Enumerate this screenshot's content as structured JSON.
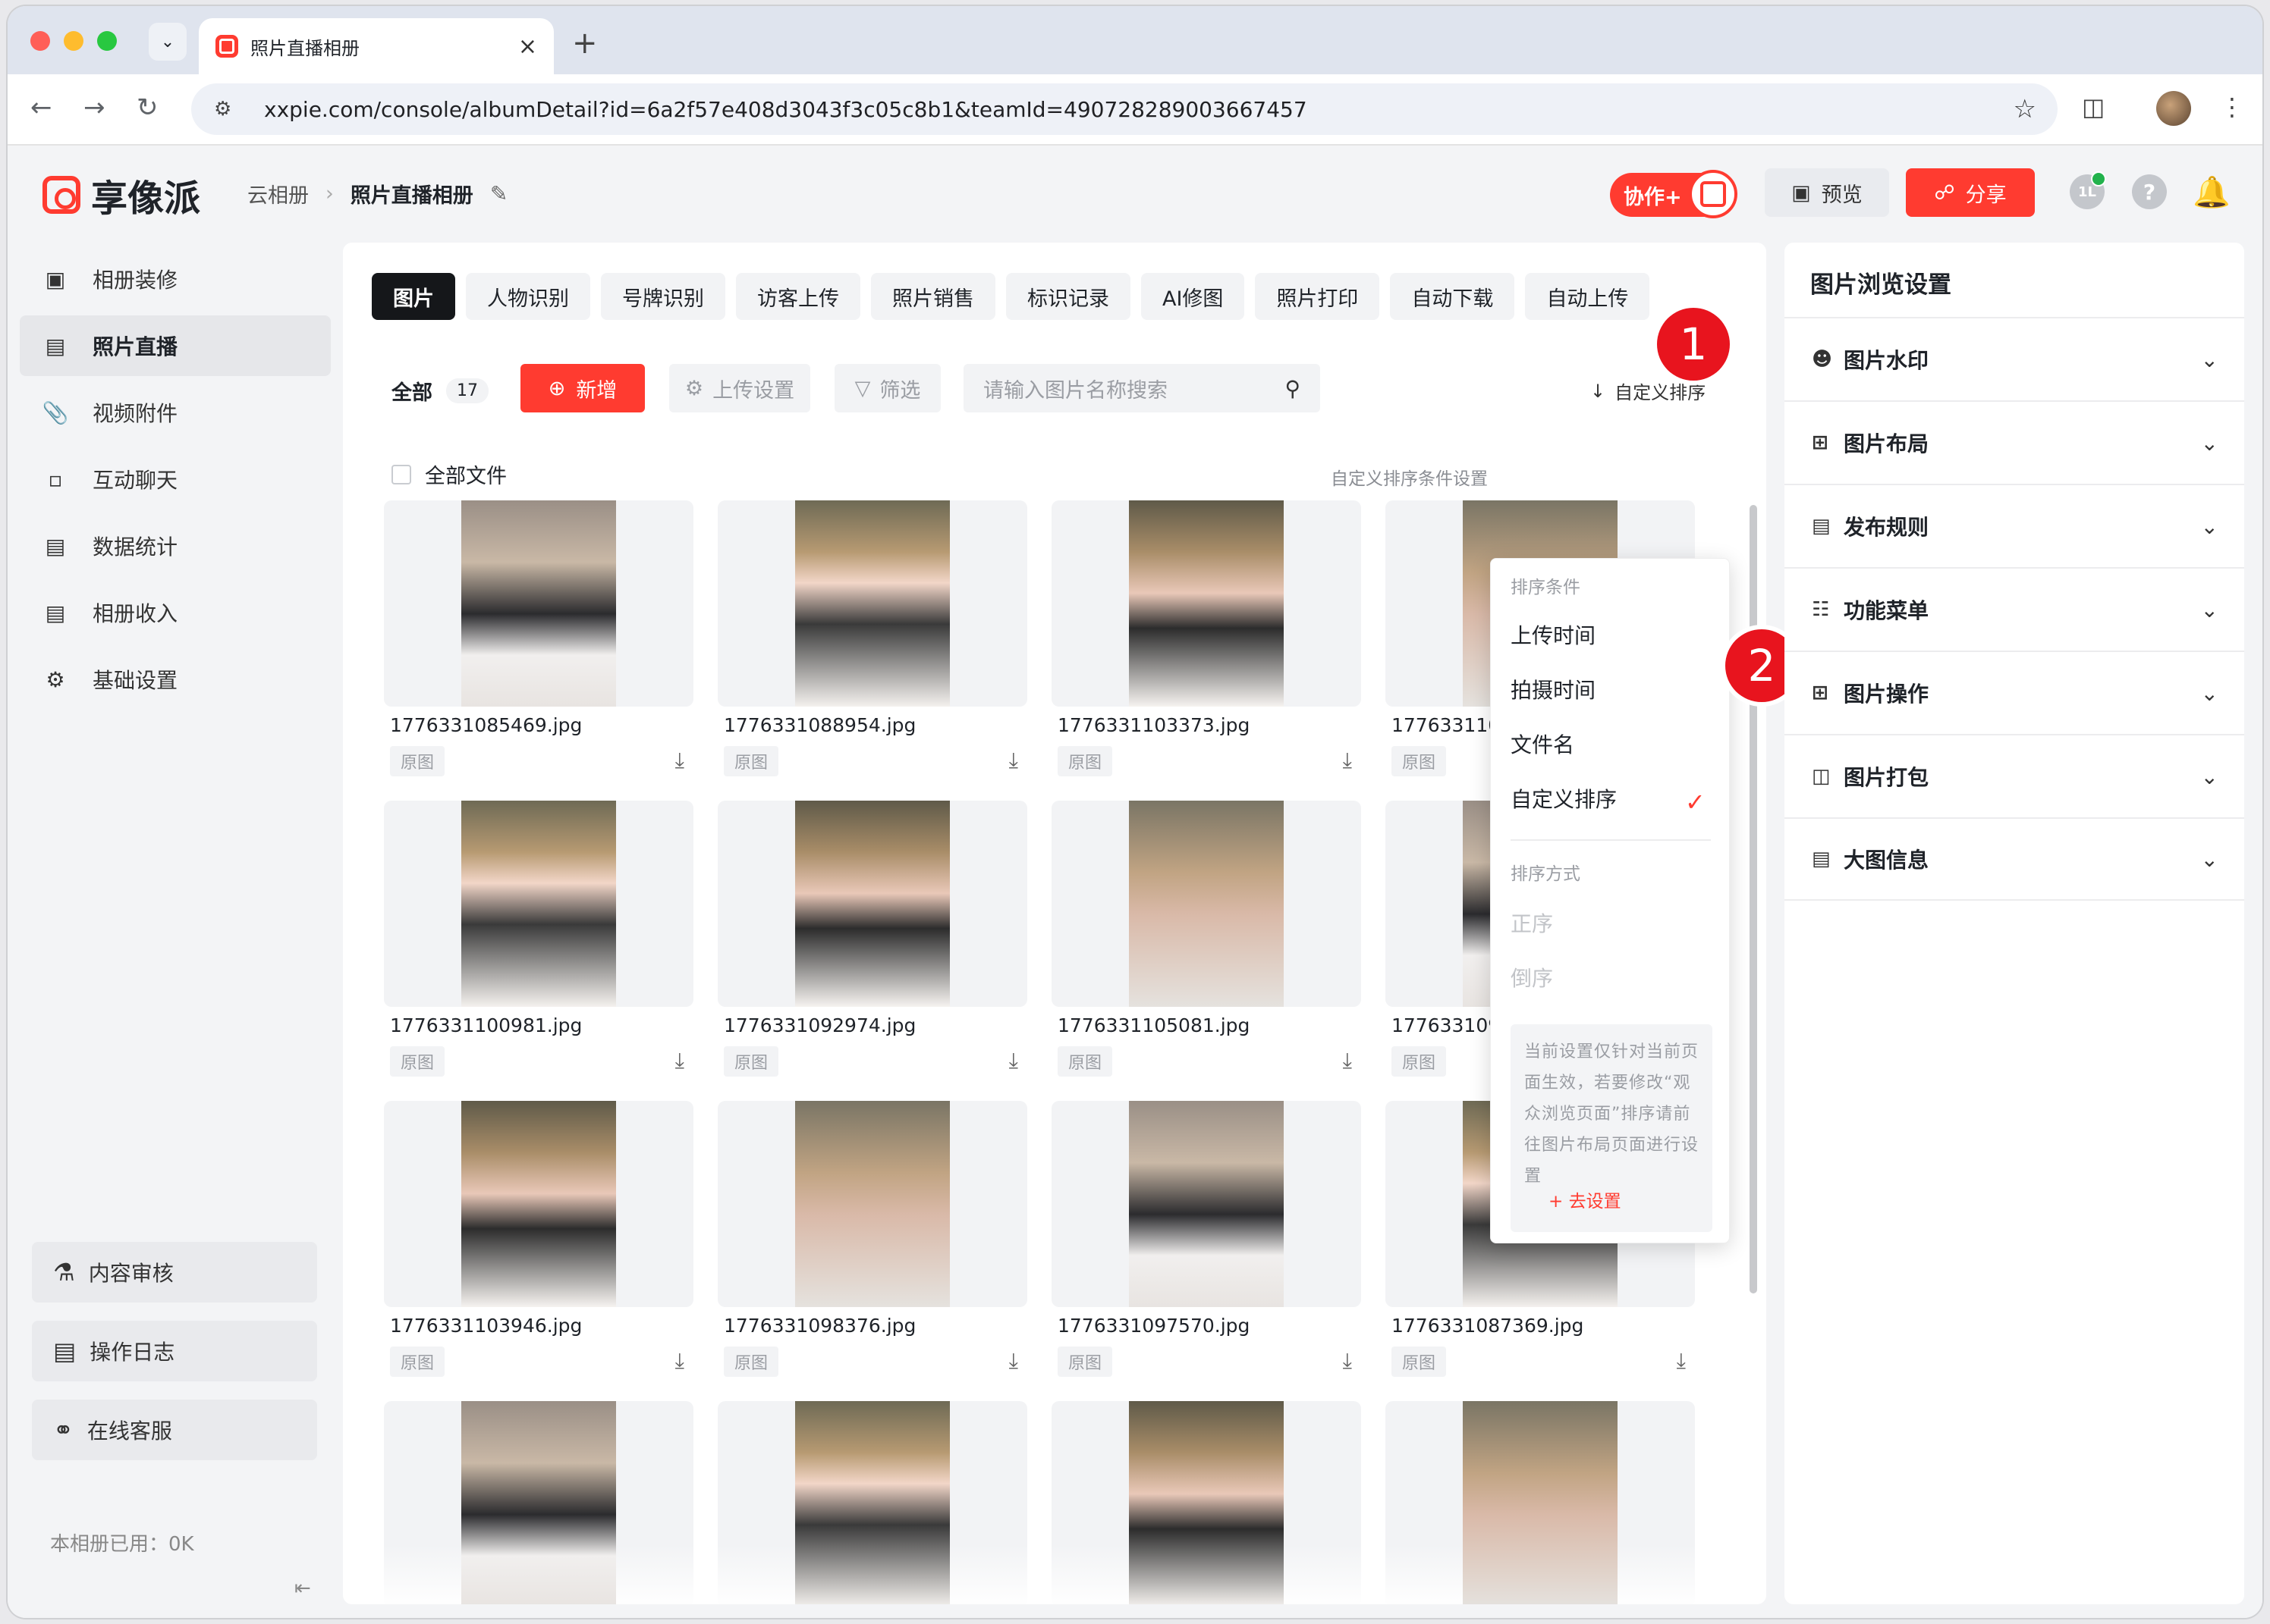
{
  "browser": {
    "tab_title": "照片直播相册",
    "url": "xxpie.com/console/albumDetail?id=6a2f57e408d3043f3c05c8b1&teamId=490728289003667457"
  },
  "header": {
    "brand": "享像派",
    "breadcrumb_root": "云相册",
    "breadcrumb_current": "照片直播相册",
    "collab_label": "协作+",
    "preview_label": "预览",
    "share_label": "分享"
  },
  "sidebar": {
    "items": [
      {
        "label": "相册装修",
        "icon": "frame-icon"
      },
      {
        "label": "照片直播",
        "icon": "image-icon"
      },
      {
        "label": "视频附件",
        "icon": "paperclip-icon"
      },
      {
        "label": "互动聊天",
        "icon": "chat-icon"
      },
      {
        "label": "数据统计",
        "icon": "chart-icon"
      },
      {
        "label": "相册收入",
        "icon": "wallet-icon"
      },
      {
        "label": "基础设置",
        "icon": "gear-icon"
      }
    ],
    "bottom_buttons": [
      "内容审核",
      "操作日志",
      "在线客服"
    ],
    "usage": "本相册已用：0K"
  },
  "main": {
    "tabs": [
      "图片",
      "人物识别",
      "号牌识别",
      "访客上传",
      "照片销售",
      "标识记录",
      "AI修图",
      "照片打印",
      "自动下载",
      "自动上传"
    ],
    "all_label": "全部",
    "count": "17",
    "add_label": "新增",
    "upload_settings": "上传设置",
    "filter_label": "筛选",
    "search_placeholder": "请输入图片名称搜索",
    "sort_label": "自定义排序",
    "select_all": "全部文件",
    "sort_cond_label": "自定义排序条件设置",
    "original_label": "原图",
    "photos": [
      "1776331085469.jpg",
      "1776331088954.jpg",
      "1776331103373.jpg",
      "1776331102",
      "1776331100981.jpg",
      "1776331092974.jpg",
      "1776331105081.jpg",
      "1776331091",
      "1776331103946.jpg",
      "1776331098376.jpg",
      "1776331097570.jpg",
      "1776331087369.jpg",
      "",
      "",
      "",
      ""
    ]
  },
  "sort_dropdown": {
    "cond_header": "排序条件",
    "options": [
      "上传时间",
      "拍摄时间",
      "文件名",
      "自定义排序"
    ],
    "selected": "自定义排序",
    "order_header": "排序方式",
    "orders": [
      "正序",
      "倒序"
    ],
    "note": "当前设置仅针对当前页面生效，若要修改“观众浏览页面”排序请前往图片布局页面进行设置",
    "go_settings": "去设置"
  },
  "annotations": [
    "1",
    "2"
  ],
  "right_panel": {
    "title": "图片浏览设置",
    "items": [
      {
        "label": "图片水印",
        "icon": "user-icon"
      },
      {
        "label": "图片布局",
        "icon": "layout-icon"
      },
      {
        "label": "发布规则",
        "icon": "rule-icon"
      },
      {
        "label": "功能菜单",
        "icon": "menu-icon"
      },
      {
        "label": "图片操作",
        "icon": "grid-icon"
      },
      {
        "label": "图片打包",
        "icon": "package-icon"
      },
      {
        "label": "大图信息",
        "icon": "photo-info-icon"
      }
    ]
  },
  "colors": {
    "accent": "#ff3b30",
    "active_tab": "#15171a",
    "sidebar_active": "#e6e7ea"
  }
}
